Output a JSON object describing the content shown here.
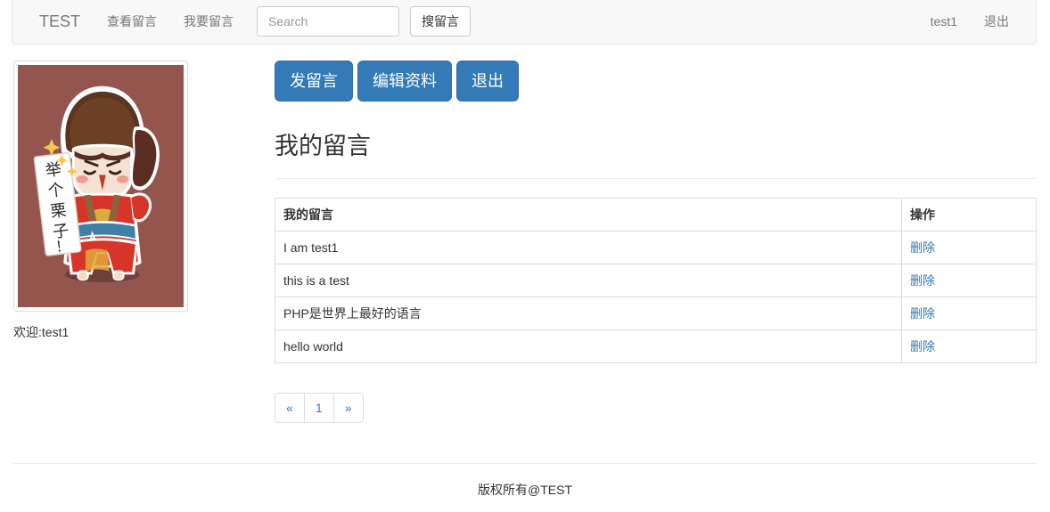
{
  "navbar": {
    "brand": "TEST",
    "links": [
      {
        "label": "查看留言"
      },
      {
        "label": "我要留言"
      }
    ],
    "search": {
      "placeholder": "Search",
      "value": "",
      "button_label": "搜留言"
    },
    "right": [
      {
        "label": "test1"
      },
      {
        "label": "退出"
      }
    ]
  },
  "sidebar": {
    "avatar_alt": "举个栗子",
    "avatar_sign_text": "举个栗子！",
    "avatar_bg_color": "#95554f",
    "welcome": "欢迎:test1"
  },
  "main": {
    "actions": [
      {
        "label": "发留言"
      },
      {
        "label": "编辑资料"
      },
      {
        "label": "退出"
      }
    ],
    "title": "我的留言",
    "table": {
      "headers": [
        "我的留言",
        "操作"
      ],
      "rows": [
        {
          "message": "I am test1",
          "action": "删除"
        },
        {
          "message": "this is a test",
          "action": "删除"
        },
        {
          "message": "PHP是世界上最好的语言",
          "action": "删除"
        },
        {
          "message": "hello world",
          "action": "删除"
        }
      ]
    },
    "pagination": [
      {
        "label": "«"
      },
      {
        "label": "1"
      },
      {
        "label": "»"
      }
    ]
  },
  "footer": {
    "copyright": "版权所有@TEST"
  },
  "colors": {
    "primary": "#337ab7",
    "navbar_bg": "#f8f8f8",
    "link": "#337ab7"
  }
}
